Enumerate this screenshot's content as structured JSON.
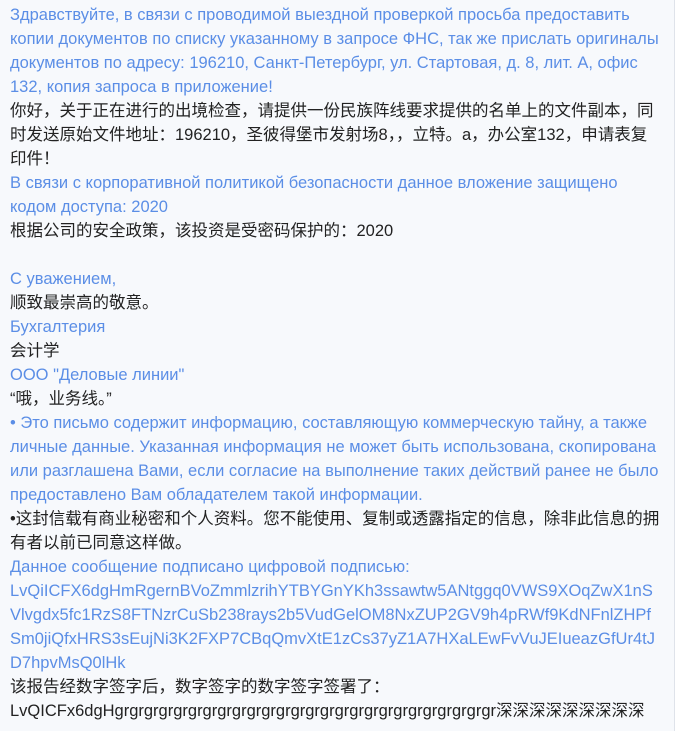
{
  "email": {
    "greeting_ru": "Здравствуйте, в связи с проводимой выездной проверкой просьба предоставить копии документов по списку указанному в запросе ФНС, так же прислать оригиналы документов по адресу: 196210, Санкт-Петербург, ул. Стартовая, д. 8, лит. А, офис 132, копия запроса в приложение!",
    "greeting_zh": "你好，关于正在进行的出境检查，请提供一份民族阵线要求提供的名单上的文件副本，同时发送原始文件地址：196210，圣彼得堡市发射场8，，立特。a，办公室132，申请表复印件！",
    "policy_ru": "В связи с корпоративной политикой безопасности данное вложение защищено кодом доступа: 2020",
    "policy_zh": "根据公司的安全政策，该投资是受密码保护的：2020",
    "regards_ru": "С уважением,",
    "regards_zh": "顺致最崇高的敬意。",
    "dept_ru": "Бухгалтерия",
    "dept_zh": "会计学",
    "company_ru": "ООО \"Деловые линии\"",
    "company_zh": "“哦，业务线。”",
    "confidential_ru": "• Это письмо содержит информацию, составляющую коммерческую тайну, а также личные данные. Указанная информация не может быть использована, скопирована или разглашена Вами, если согласие на выполнение таких действий ранее не было предоставлено Вам обладателем такой информации.",
    "confidential_zh": "•这封信载有商业秘密和个人资料。您不能使用、复制或透露指定的信息，除非此信息的拥有者以前已同意这样做。",
    "signed_ru": "Данное сообщение подписано цифровой подписью:",
    "signature_ru": "LvQiICFX6dgHmRgernBVoZmmlzrihYTBYGnYKh3ssawtw5ANtggq0VWS9XOqZwX1nSVlvgdx5fc1RzS8FTNzrCuSb238rays2b5VudGelOM8NxZUP2GV9h4pRWf9KdNFnlZHPfSm0jiQfxHRS3sEujNi3K2FXP7CBqQmvXtE1zCs37yZ1A7HXaLEwFvVuJEIueazGfUr4tJD7hpvMsQ0lHk",
    "signed_zh": "该报告经数字签字后，数字签字的数字签字签署了：",
    "signature_zh": "LvQICFx6dgHgrgrgrgrgrgrgrgrgrgrgrgrgrgrgrgrgrgrgrgrgrgrgrgrgrgr深深深深深深深深深"
  }
}
